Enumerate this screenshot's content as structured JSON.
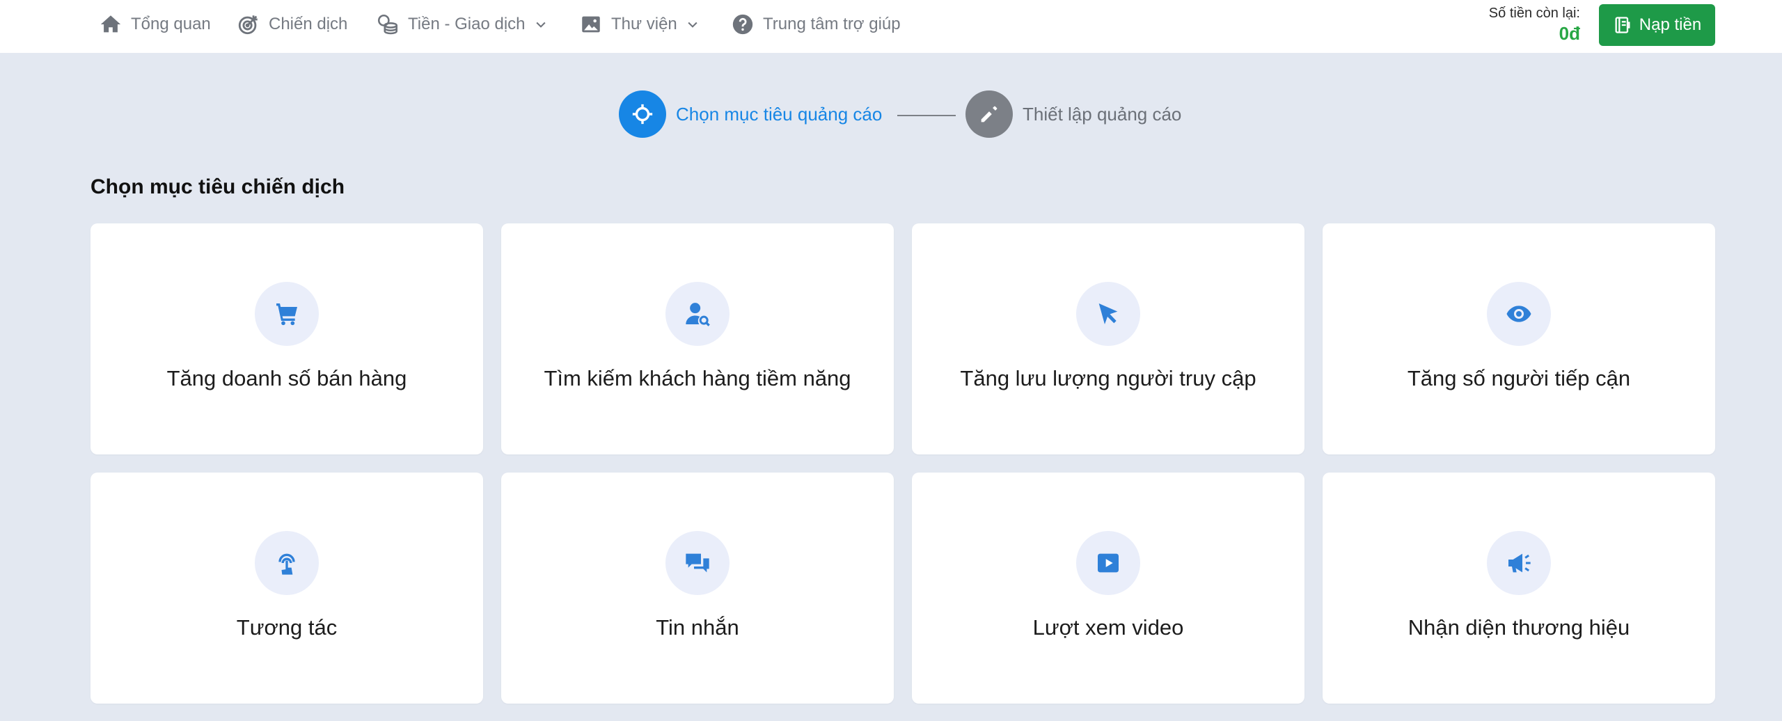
{
  "nav": {
    "items": [
      {
        "label": "Tổng quan",
        "icon": "home-icon"
      },
      {
        "label": "Chiến dịch",
        "icon": "target-icon"
      },
      {
        "label": "Tiền - Giao dịch",
        "icon": "coins-icon",
        "dropdown": true
      },
      {
        "label": "Thư viện",
        "icon": "image-library-icon",
        "dropdown": true
      },
      {
        "label": "Trung tâm trợ giúp",
        "icon": "help-icon"
      }
    ],
    "balance_label": "Số tiền còn lại:",
    "balance_value": "0đ",
    "topup_label": "Nạp tiền"
  },
  "stepper": {
    "steps": [
      {
        "label": "Chọn mục tiêu quảng cáo",
        "state": "active",
        "icon": "crosshair-icon"
      },
      {
        "label": "Thiết lập quảng cáo",
        "state": "inactive",
        "icon": "pencil-icon"
      }
    ]
  },
  "section": {
    "title": "Chọn mục tiêu chiến dịch"
  },
  "objectives": [
    {
      "label": "Tăng doanh số bán hàng",
      "icon": "cart-icon"
    },
    {
      "label": "Tìm kiếm khách hàng tiềm năng",
      "icon": "user-search-icon"
    },
    {
      "label": "Tăng lưu lượng người truy cập",
      "icon": "cursor-icon"
    },
    {
      "label": "Tăng số người tiếp cận",
      "icon": "eye-icon"
    },
    {
      "label": "Tương tác",
      "icon": "touch-icon"
    },
    {
      "label": "Tin nhắn",
      "icon": "chat-icon"
    },
    {
      "label": "Lượt xem video",
      "icon": "video-play-icon"
    },
    {
      "label": "Nhận diện thương hiệu",
      "icon": "megaphone-icon"
    }
  ],
  "colors": {
    "primary": "#1786e5",
    "success": "#1e9a48",
    "balance": "#28a745",
    "background": "#e3e8f1",
    "icon_bg": "#eaeefa",
    "icon": "#2f80d8"
  }
}
